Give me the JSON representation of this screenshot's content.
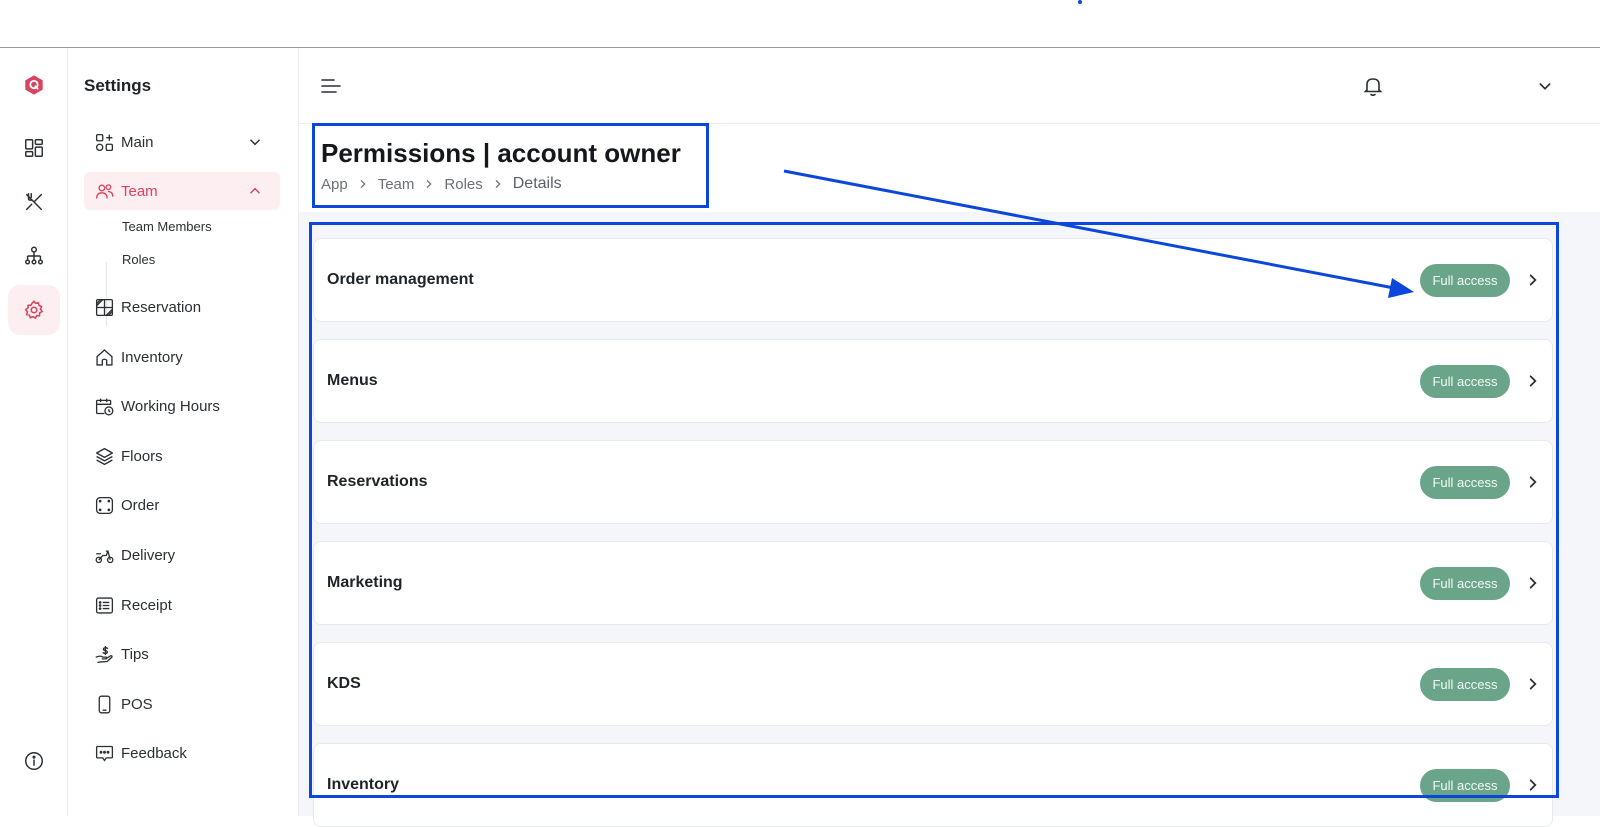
{
  "sidebar": {
    "title": "Settings",
    "items": [
      {
        "key": "main",
        "label": "Main",
        "icon": "apps-add-icon"
      },
      {
        "key": "team",
        "label": "Team",
        "icon": "users-icon"
      },
      {
        "key": "reservation",
        "label": "Reservation",
        "icon": "grid-diagonal-icon"
      },
      {
        "key": "inventory",
        "label": "Inventory",
        "icon": "home-icon"
      },
      {
        "key": "working_hours",
        "label": "Working Hours",
        "icon": "calendar-clock-icon"
      },
      {
        "key": "floors",
        "label": "Floors",
        "icon": "layers-icon"
      },
      {
        "key": "order",
        "label": "Order",
        "icon": "frame-icon"
      },
      {
        "key": "delivery",
        "label": "Delivery",
        "icon": "scooter-icon"
      },
      {
        "key": "receipt",
        "label": "Receipt",
        "icon": "list-icon"
      },
      {
        "key": "tips",
        "label": "Tips",
        "icon": "hand-dollar-icon"
      },
      {
        "key": "pos",
        "label": "POS",
        "icon": "device-icon"
      },
      {
        "key": "feedback",
        "label": "Feedback",
        "icon": "chat-icon"
      }
    ],
    "team_sub": [
      "Team Members",
      "Roles"
    ]
  },
  "page": {
    "title": "Permissions | account owner",
    "breadcrumb": [
      "App",
      "Team",
      "Roles",
      "Details"
    ]
  },
  "permissions": [
    {
      "name": "Order management",
      "access": "Full access"
    },
    {
      "name": "Menus",
      "access": "Full access"
    },
    {
      "name": "Reservations",
      "access": "Full access"
    },
    {
      "name": "Marketing",
      "access": "Full access"
    },
    {
      "name": "KDS",
      "access": "Full access"
    },
    {
      "name": "Inventory",
      "access": "Full access"
    }
  ],
  "colors": {
    "accent": "#d8435d",
    "badge": "#6aa58a",
    "annotation": "#0b47db"
  }
}
